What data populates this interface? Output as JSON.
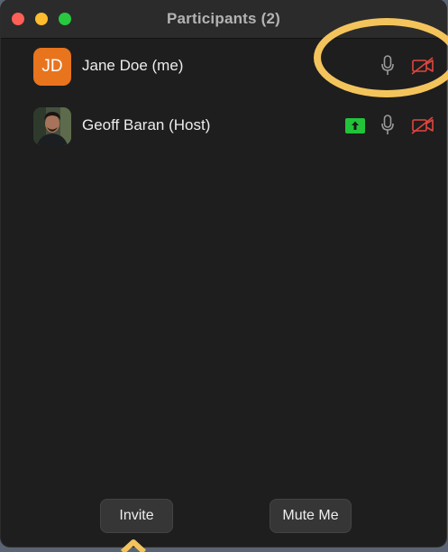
{
  "window": {
    "title": "Participants (2)"
  },
  "participants": [
    {
      "name": "Jane Doe (me)",
      "initials": "JD",
      "avatar_color": "#e8741e",
      "mic_icon": "microphone-icon",
      "video_icon": "video-off-icon",
      "video_off": true
    },
    {
      "name": "Geoff Baran (Host)",
      "avatar": "photo",
      "sharing": true,
      "share_icon": "share-screen-icon",
      "mic_icon": "microphone-icon",
      "video_icon": "video-off-icon",
      "video_off": true
    }
  ],
  "footer": {
    "invite_label": "Invite",
    "mute_label": "Mute Me"
  },
  "colors": {
    "highlight": "#f4c45c",
    "video_off": "#e0463f",
    "share": "#22c33a"
  }
}
